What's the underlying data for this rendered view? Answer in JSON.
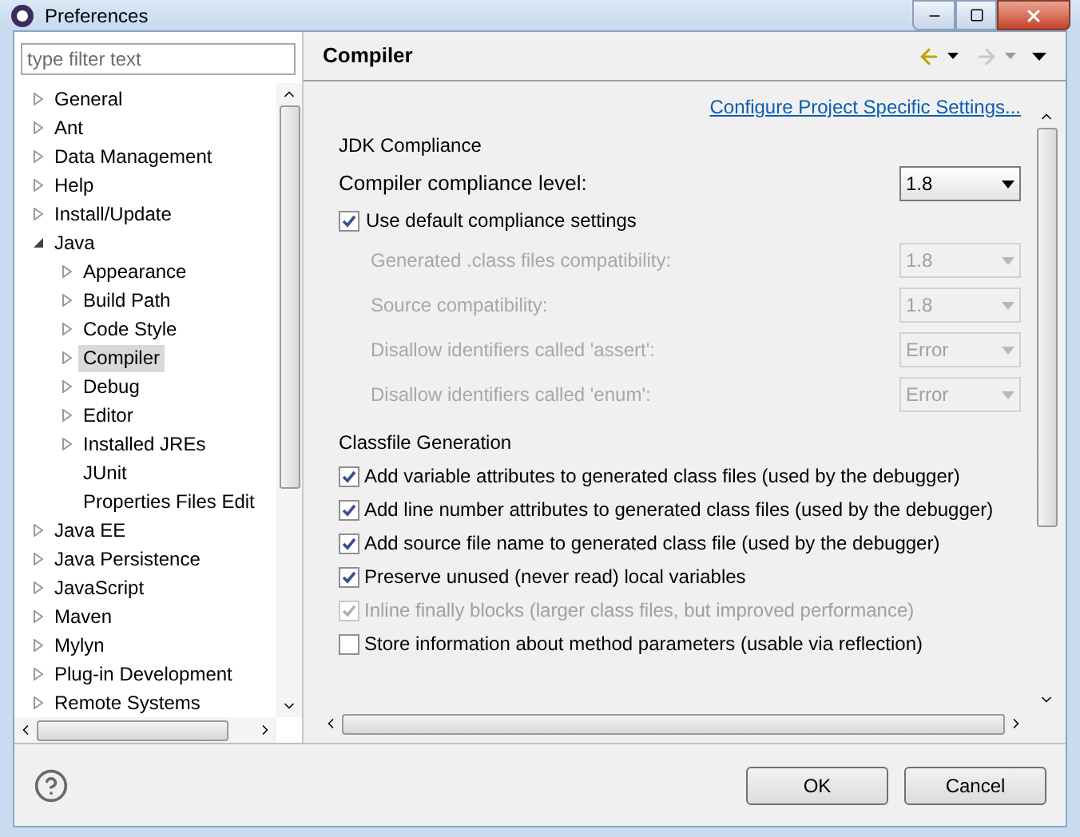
{
  "window": {
    "title": "Preferences"
  },
  "filter": {
    "placeholder": "type filter text"
  },
  "tree": [
    {
      "label": "General",
      "expanded": false,
      "selected": false
    },
    {
      "label": "Ant",
      "expanded": false,
      "selected": false
    },
    {
      "label": "Data Management",
      "expanded": false,
      "selected": false
    },
    {
      "label": "Help",
      "expanded": false,
      "selected": false
    },
    {
      "label": "Install/Update",
      "expanded": false,
      "selected": false
    },
    {
      "label": "Java",
      "expanded": true,
      "selected": false,
      "children": [
        {
          "label": "Appearance",
          "expanded": false,
          "selected": false
        },
        {
          "label": "Build Path",
          "expanded": false,
          "selected": false
        },
        {
          "label": "Code Style",
          "expanded": false,
          "selected": false
        },
        {
          "label": "Compiler",
          "expanded": false,
          "selected": true
        },
        {
          "label": "Debug",
          "expanded": false,
          "selected": false
        },
        {
          "label": "Editor",
          "expanded": false,
          "selected": false
        },
        {
          "label": "Installed JREs",
          "expanded": false,
          "selected": false
        },
        {
          "label": "JUnit",
          "selected": false
        },
        {
          "label": "Properties Files Edit",
          "selected": false
        }
      ]
    },
    {
      "label": "Java EE",
      "expanded": false,
      "selected": false
    },
    {
      "label": "Java Persistence",
      "expanded": false,
      "selected": false
    },
    {
      "label": "JavaScript",
      "expanded": false,
      "selected": false
    },
    {
      "label": "Maven",
      "expanded": false,
      "selected": false
    },
    {
      "label": "Mylyn",
      "expanded": false,
      "selected": false
    },
    {
      "label": "Plug-in Development",
      "expanded": false,
      "selected": false
    },
    {
      "label": "Remote Systems",
      "expanded": false,
      "selected": false
    }
  ],
  "page": {
    "title": "Compiler",
    "link": "Configure Project Specific Settings...",
    "jdk": {
      "heading": "JDK Compliance",
      "compliance": {
        "label": "Compiler compliance level:",
        "value": "1.8",
        "disabled": false
      },
      "use_default": {
        "label": "Use default compliance settings",
        "checked": true,
        "disabled": false
      },
      "settings": [
        {
          "label": "Generated .class files compatibility:",
          "value": "1.8",
          "disabled": true
        },
        {
          "label": "Source compatibility:",
          "value": "1.8",
          "disabled": true
        },
        {
          "label": "Disallow identifiers called 'assert':",
          "value": "Error",
          "disabled": true
        },
        {
          "label": "Disallow identifiers called 'enum':",
          "value": "Error",
          "disabled": true
        }
      ]
    },
    "classfile": {
      "heading": "Classfile Generation",
      "options": [
        {
          "label": "Add variable attributes to generated class files (used by the debugger)",
          "checked": true,
          "disabled": false
        },
        {
          "label": "Add line number attributes to generated class files (used by the debugger)",
          "checked": true,
          "disabled": false
        },
        {
          "label": "Add source file name to generated class file (used by the debugger)",
          "checked": true,
          "disabled": false
        },
        {
          "label": "Preserve unused (never read) local variables",
          "checked": true,
          "disabled": false
        },
        {
          "label": "Inline finally blocks (larger class files, but improved performance)",
          "checked": true,
          "disabled": true
        },
        {
          "label": "Store information about method parameters (usable via reflection)",
          "checked": false,
          "disabled": false
        }
      ]
    }
  },
  "buttons": [
    "OK",
    "Cancel"
  ]
}
